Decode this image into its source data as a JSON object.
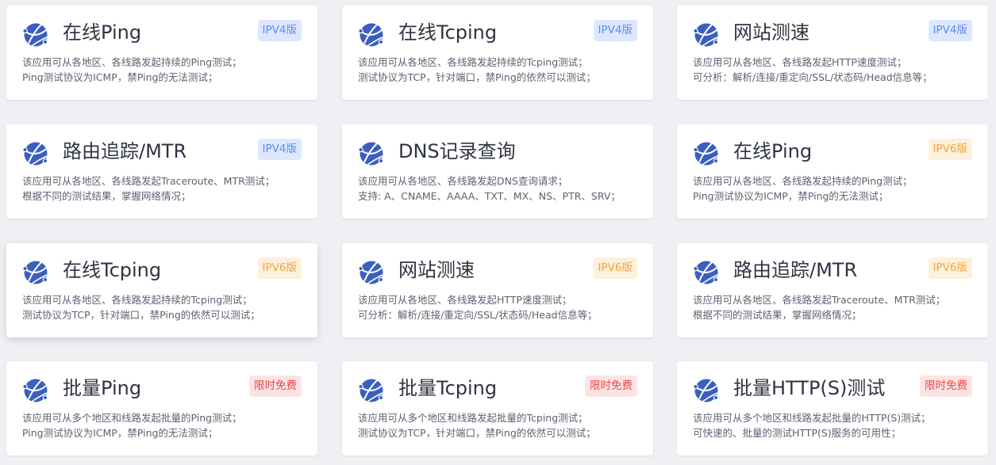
{
  "colors": {
    "ipv4_bg": "#dde8ff",
    "ipv4_text": "#5b8cf0",
    "ipv6_bg": "#fdf0dc",
    "ipv6_text": "#f0a63b",
    "free_bg": "#fde4e4",
    "free_text": "#e8474b",
    "icon": "#3b5fbe"
  },
  "cards": [
    {
      "title": "在线Ping",
      "badge": "IPV4版",
      "badge_type": "v4",
      "icon": "globe-icon",
      "line1": "该应用可从各地区、各线路发起持续的Ping测试；",
      "line2": "Ping测试协议为ICMP，禁Ping的无法测试；"
    },
    {
      "title": "在线Tcping",
      "badge": "IPV4版",
      "badge_type": "v4",
      "icon": "globe-icon",
      "line1": "该应用可从各地区、各线路发起持续的Tcping测试；",
      "line2": "测试协议为TCP，针对端口，禁Ping的依然可以测试；"
    },
    {
      "title": "网站测速",
      "badge": "IPV4版",
      "badge_type": "v4",
      "icon": "globe-icon",
      "line1": "该应用可从各地区、各线路发起HTTP速度测试；",
      "line2": "可分析：解析/连接/重定向/SSL/状态码/Head信息等；"
    },
    {
      "title": "路由追踪/MTR",
      "badge": "IPV4版",
      "badge_type": "v4",
      "icon": "globe-icon",
      "line1": "该应用可从各地区、各线路发起Traceroute、MTR测试；",
      "line2": "根据不同的测试结果，掌握网络情况；"
    },
    {
      "title": "DNS记录查询",
      "badge": "",
      "badge_type": "",
      "icon": "globe-icon",
      "line1": "该应用可从各地区、各线路发起DNS查询请求；",
      "line2": "支持: A、CNAME、AAAA、TXT、MX、NS、PTR、SRV；"
    },
    {
      "title": "在线Ping",
      "badge": "IPV6版",
      "badge_type": "v6",
      "icon": "globe-icon",
      "line1": "该应用可从各地区、各线路发起持续的Ping测试；",
      "line2": "Ping测试协议为ICMP，禁Ping的无法测试；"
    },
    {
      "title": "在线Tcping",
      "badge": "IPV6版",
      "badge_type": "v6",
      "icon": "globe-icon",
      "line1": "该应用可从各地区、各线路发起持续的Tcping测试；",
      "line2": "测试协议为TCP，针对端口，禁Ping的依然可以测试；"
    },
    {
      "title": "网站测速",
      "badge": "IPV6版",
      "badge_type": "v6",
      "icon": "globe-icon",
      "line1": "该应用可从各地区、各线路发起HTTP速度测试；",
      "line2": "可分析：解析/连接/重定向/SSL/状态码/Head信息等；"
    },
    {
      "title": "路由追踪/MTR",
      "badge": "IPV6版",
      "badge_type": "v6",
      "icon": "globe-icon",
      "line1": "该应用可从各地区、各线路发起Traceroute、MTR测试；",
      "line2": "根据不同的测试结果，掌握网络情况；"
    },
    {
      "title": "批量Ping",
      "badge": "限时免费",
      "badge_type": "free",
      "icon": "globe-icon",
      "line1": "该应用可从多个地区和线路发起批量的Ping测试；",
      "line2": "Ping测试协议为ICMP，禁Ping的无法测试；"
    },
    {
      "title": "批量Tcping",
      "badge": "限时免费",
      "badge_type": "free",
      "icon": "globe-icon",
      "line1": "该应用可从多个地区和线路发起批量的Tcping测试；",
      "line2": "测试协议为TCP，针对端口，禁Ping的依然可以测试；"
    },
    {
      "title": "批量HTTP(S)测试",
      "badge": "限时免费",
      "badge_type": "free",
      "icon": "globe-icon",
      "line1": "该应用可从多个地区和线路发起批量的HTTP(S)测试；",
      "line2": "可快速的、批量的测试HTTP(S)服务的可用性；"
    }
  ]
}
